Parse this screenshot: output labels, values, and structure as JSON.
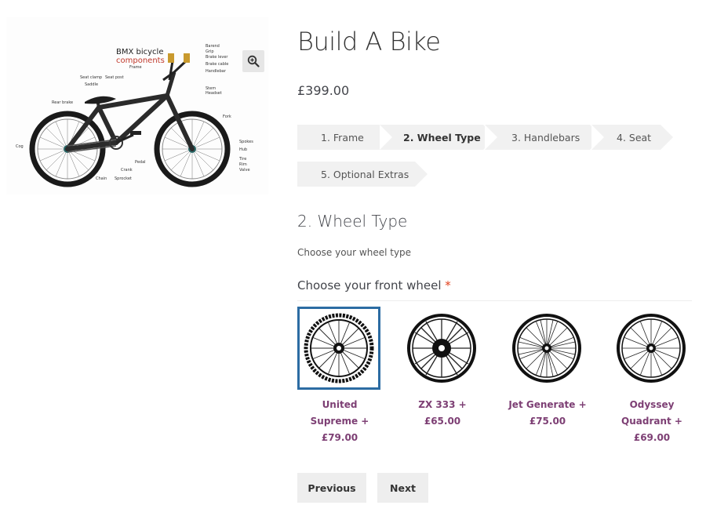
{
  "gallery": {
    "diagram_title": "BMX bicycle",
    "diagram_subtitle": "components",
    "labels": {
      "barend": "Barend",
      "grip": "Grip",
      "brake_lever": "Brake lever",
      "brake_cable": "Brake cable",
      "handlebar": "Handlebar",
      "frame": "Frame",
      "seat_clamp": "Seat clamp",
      "seat_post": "Seat post",
      "saddle": "Saddle",
      "stem": "Stem",
      "headset": "Headset",
      "rear_brake": "Rear brake",
      "fork": "Fork",
      "cog": "Cog",
      "spokes": "Spokes",
      "hub": "Hub",
      "pedal": "Pedal",
      "tire": "Tire",
      "rim": "Rim",
      "valve": "Valve",
      "crank": "Crank",
      "chain": "Chain",
      "sprocket": "Sprocket"
    },
    "zoom_icon": "magnifier-plus-icon"
  },
  "product": {
    "title": "Build A Bike",
    "price": "£399.00"
  },
  "steps": [
    {
      "label": "1. Frame",
      "active": false
    },
    {
      "label": "2. Wheel Type",
      "active": true
    },
    {
      "label": "3. Handlebars",
      "active": false
    },
    {
      "label": "4. Seat",
      "active": false
    },
    {
      "label": "5. Optional Extras",
      "active": false
    }
  ],
  "section": {
    "title": "2. Wheel Type",
    "description": "Choose your wheel type"
  },
  "field": {
    "label": "Choose your front wheel",
    "required_mark": "*"
  },
  "wheels": [
    {
      "name_line1": "United Supreme +",
      "name_line2": "£79.00",
      "name_line3": "",
      "selected": true,
      "icon": "wheel-icon"
    },
    {
      "name_line1": "ZX 333 + £65.00",
      "name_line2": "",
      "name_line3": "",
      "selected": false,
      "icon": "wheel-icon"
    },
    {
      "name_line1": "Jet Generate +",
      "name_line2": "£75.00",
      "name_line3": "",
      "selected": false,
      "icon": "wheel-icon"
    },
    {
      "name_line1": "Odyssey",
      "name_line2": "Quadrant +",
      "name_line3": "£69.00",
      "selected": false,
      "icon": "wheel-icon"
    }
  ],
  "buttons": {
    "previous": "Previous",
    "next": "Next"
  },
  "colors": {
    "accent_link": "#7d3f74",
    "selected_border": "#2c6ca3",
    "required": "#e2401c",
    "step_bg": "#f1f1f1"
  }
}
